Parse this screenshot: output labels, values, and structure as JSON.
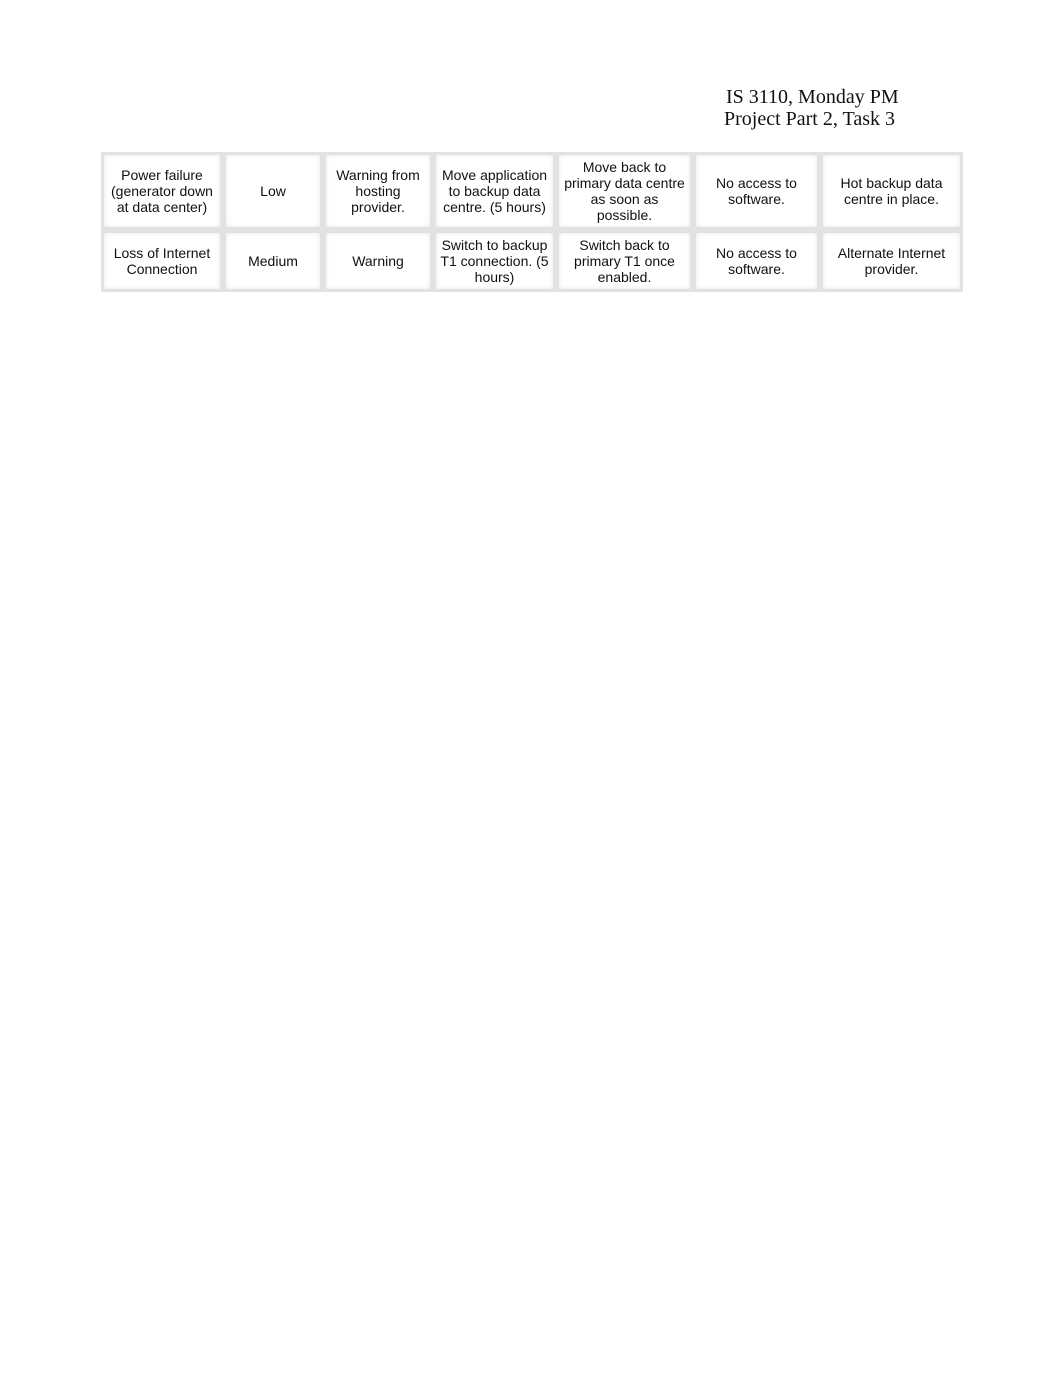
{
  "header": {
    "line1": "IS 3110, Monday PM",
    "line2": "Project Part 2, Task 3"
  },
  "table": {
    "rows": [
      {
        "cells": [
          "Power failure (generator down at data center)",
          "Low",
          "Warning from hosting provider.",
          "Move application to backup data centre. (5 hours)",
          "Move back to primary data centre as soon as possible.",
          "No access to software.",
          "Hot backup data centre in place."
        ]
      },
      {
        "cells": [
          "Loss of Internet Connection",
          "Medium",
          "Warning",
          "Switch to backup T1 connection. (5 hours)",
          "Switch back to primary T1 once enabled.",
          "No access to software.",
          "Alternate Internet provider."
        ]
      }
    ]
  }
}
